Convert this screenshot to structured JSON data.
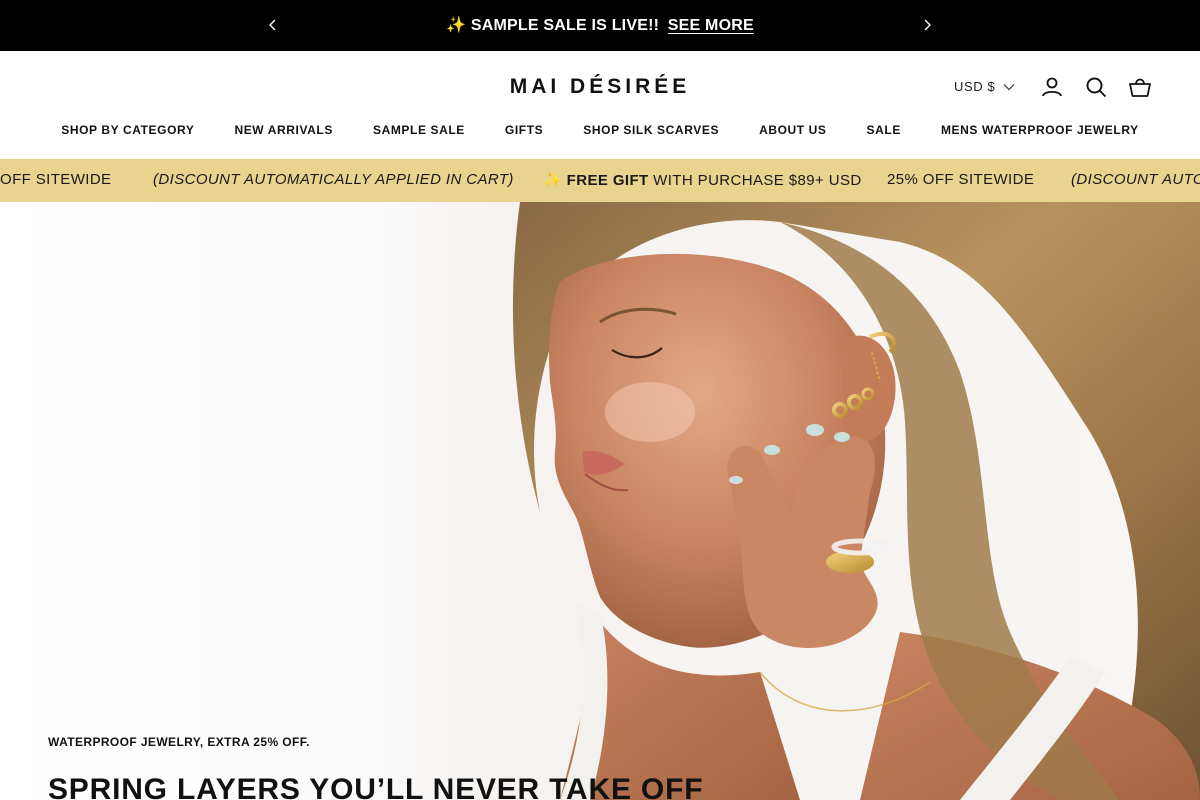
{
  "announcement": {
    "icon": "sparkles-icon",
    "text": "✨ SAMPLE SALE IS LIVE!!",
    "link_label": "SEE MORE"
  },
  "header": {
    "logo": "MAI DÉSIRÉE",
    "currency": "USD $",
    "icons": [
      "account-icon",
      "search-icon",
      "cart-icon"
    ]
  },
  "nav": {
    "items": [
      "SHOP BY CATEGORY",
      "NEW ARRIVALS",
      "SAMPLE SALE",
      "GIFTS",
      "SHOP SILK SCARVES",
      "ABOUT US",
      "SALE",
      "MENS WATERPROOF JEWELRY"
    ]
  },
  "marquee": {
    "sitewide_tail": "OFF SITEWIDE",
    "discount_note": "(DISCOUNT AUTOMATICALLY APPLIED IN CART)",
    "gift_prefix": "✨",
    "gift_bold": "FREE GIFT",
    "gift_rest": "WITH PURCHASE $89+ USD",
    "sitewide": "25% OFF SITEWIDE",
    "discount_note_partial": "(DISCOUNT AUTOM",
    "background": "#e8d38f"
  },
  "hero": {
    "eyebrow": "WATERPROOF JEWELRY, EXTRA 25% OFF.",
    "headline": "SPRING LAYERS YOU’LL NEVER TAKE OFF"
  },
  "colors": {
    "announcement_bg": "#000000",
    "marquee_bg": "#e8d38f",
    "text": "#111111"
  }
}
